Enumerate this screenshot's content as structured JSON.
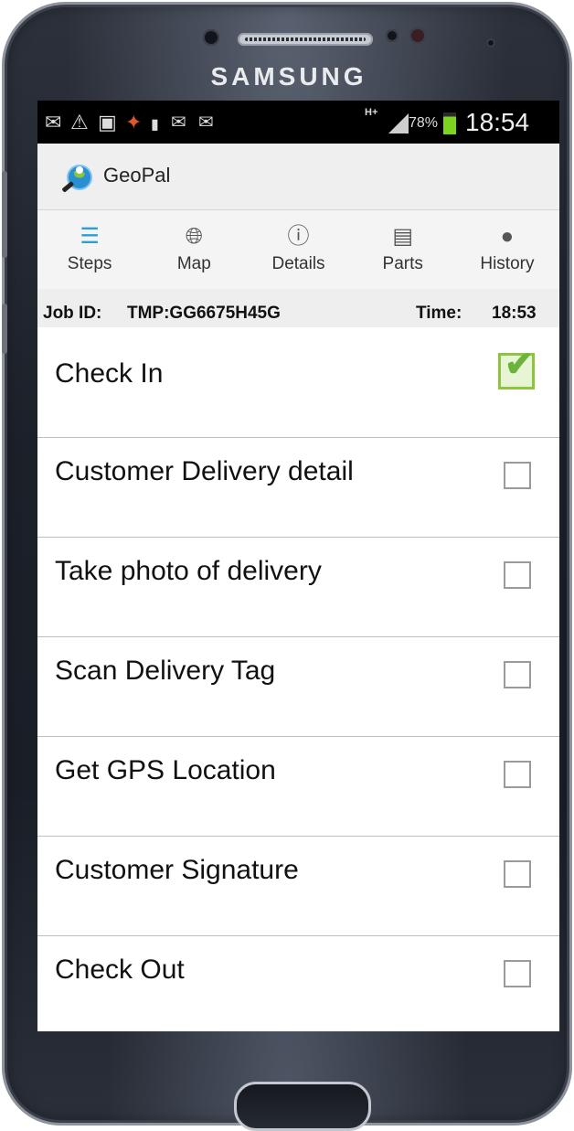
{
  "device": {
    "brand": "SAMSUNG"
  },
  "status_bar": {
    "icons": [
      "mail-icon",
      "warning-icon",
      "image-icon",
      "alert-icon",
      "sim-icon",
      "mail-at-icon",
      "mail-at-icon"
    ],
    "network": "H+",
    "battery_percent": "78%",
    "time": "18:54"
  },
  "app_bar": {
    "title": "GeoPal",
    "logo": "geopal-logo-icon"
  },
  "tabs": [
    {
      "label": "Steps",
      "icon": "list-icon",
      "active": true
    },
    {
      "label": "Map",
      "icon": "globe-icon",
      "active": false
    },
    {
      "label": "Details",
      "icon": "info-icon",
      "active": false
    },
    {
      "label": "Parts",
      "icon": "server-icon",
      "active": false
    },
    {
      "label": "History",
      "icon": "person-icon",
      "active": false
    }
  ],
  "job": {
    "id_label": "Job ID:",
    "id_value": "TMP:GG6675H45G",
    "time_label": "Time:",
    "time_value": "18:53"
  },
  "steps": [
    {
      "label": "Check In",
      "checked": true
    },
    {
      "label": "Customer Delivery detail",
      "checked": false
    },
    {
      "label": "Take photo of delivery",
      "checked": false
    },
    {
      "label": "Scan Delivery Tag",
      "checked": false
    },
    {
      "label": "Get GPS Location",
      "checked": false
    },
    {
      "label": "Customer Signature",
      "checked": false
    },
    {
      "label": "Check Out",
      "checked": false
    }
  ],
  "colors": {
    "accent": "#2a9fd6",
    "check_green": "#6bb33a",
    "battery_green": "#7bd41f"
  }
}
